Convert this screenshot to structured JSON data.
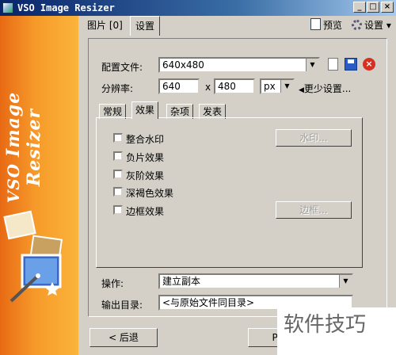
{
  "window": {
    "title": "VSO Image Resizer",
    "minimize": "_",
    "maximize": "□",
    "close": "×"
  },
  "sidebar": {
    "brand_text": "Image Resizer"
  },
  "top_tabs": [
    {
      "label": "图片 [0]"
    },
    {
      "label": "设置"
    }
  ],
  "toolbar": {
    "preview_label": "预览",
    "settings_label": "设置",
    "settings_arrow": "▾"
  },
  "config": {
    "profile_label": "配置文件:",
    "profile_value": "640x480",
    "resolution_label": "分辨率:",
    "width": "640",
    "x_sep": "x",
    "height": "480",
    "unit": "px",
    "more_label": "更少设置..."
  },
  "inner_tabs": [
    {
      "label": "常规"
    },
    {
      "label": "效果"
    },
    {
      "label": "杂项"
    },
    {
      "label": "发表"
    }
  ],
  "effects": {
    "items": [
      {
        "label": "整合水印"
      },
      {
        "label": "负片效果"
      },
      {
        "label": "灰阶效果"
      },
      {
        "label": "深褐色效果"
      },
      {
        "label": "边框效果"
      }
    ],
    "watermark_button": "水印...",
    "border_button": "边框..."
  },
  "operation": {
    "label": "操作:",
    "value": "建立副本"
  },
  "output": {
    "label": "输出目录:",
    "value": "<与原始文件同目录>"
  },
  "nav": {
    "back_label": "< 后退",
    "next_label": "Pro"
  },
  "watermark_text": "软件技巧"
}
